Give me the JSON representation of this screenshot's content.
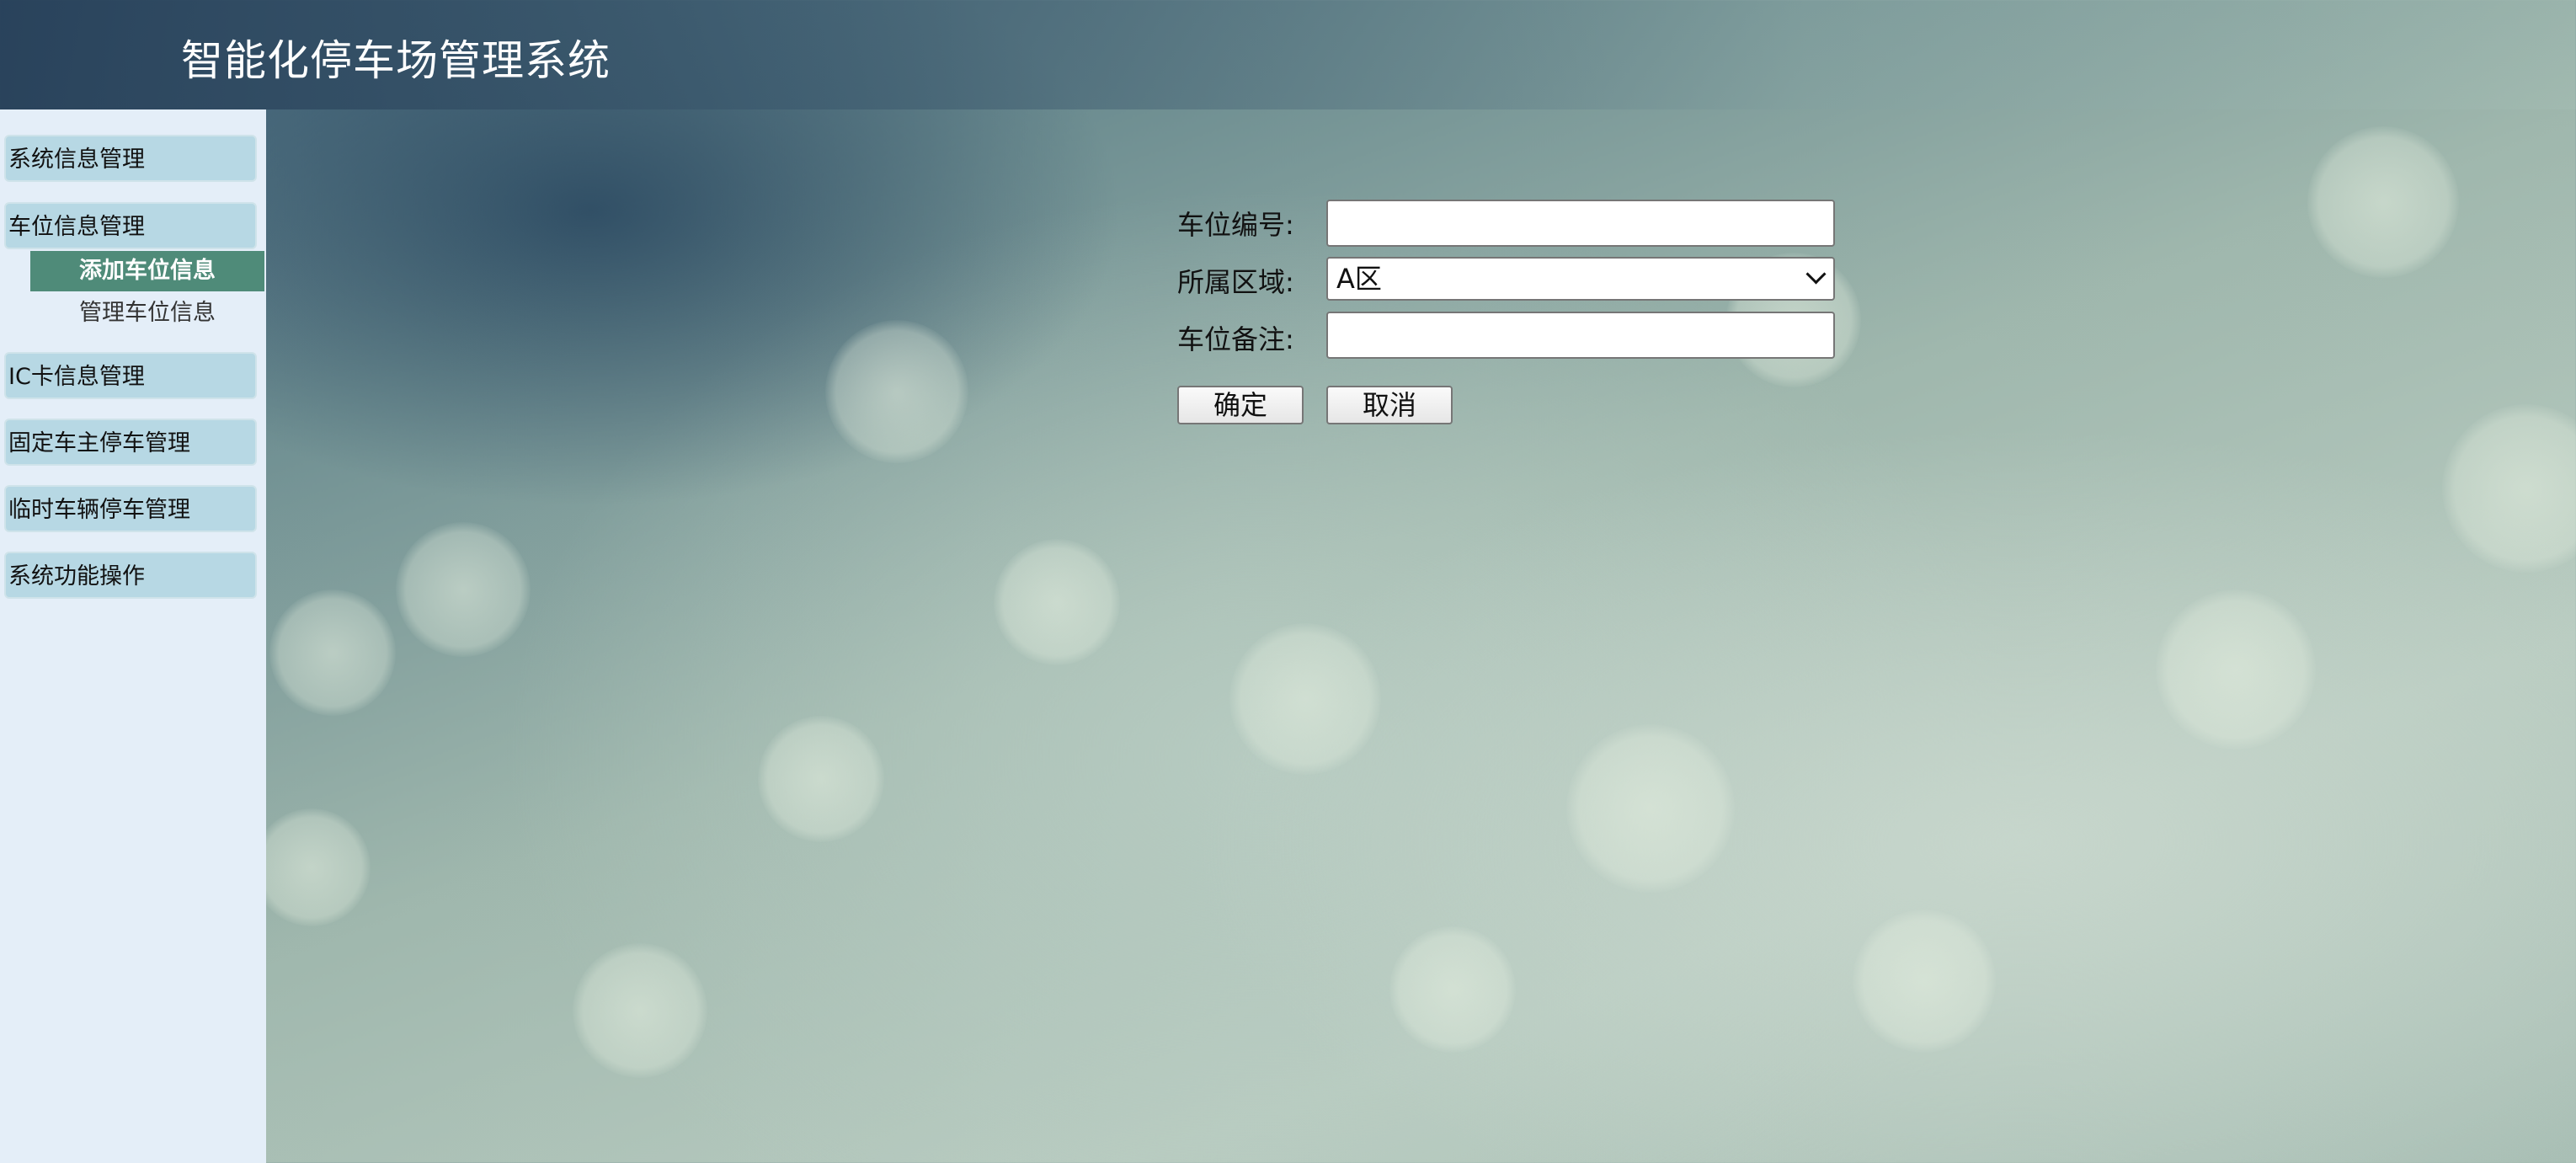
{
  "header": {
    "title": "智能化停车场管理系统"
  },
  "sidebar": {
    "groups": [
      {
        "label": "系统信息管理"
      },
      {
        "label": "车位信息管理"
      },
      {
        "label": "IC卡信息管理"
      },
      {
        "label": "固定车主停车管理"
      },
      {
        "label": "临时车辆停车管理"
      },
      {
        "label": "系统功能操作"
      }
    ],
    "submenu": [
      {
        "label": "添加车位信息",
        "active": true
      },
      {
        "label": "管理车位信息",
        "active": false
      }
    ]
  },
  "form": {
    "space_number_label": "车位编号:",
    "space_number_value": "",
    "area_label": "所属区域:",
    "area_selected": "A区",
    "remark_label": "车位备注:",
    "remark_value": "",
    "confirm_label": "确定",
    "cancel_label": "取消"
  },
  "colors": {
    "submenu_active_bg": "#4f8b79",
    "menu_group_bg": "#b7d8e4",
    "sidebar_bg": "#e4eef8"
  }
}
